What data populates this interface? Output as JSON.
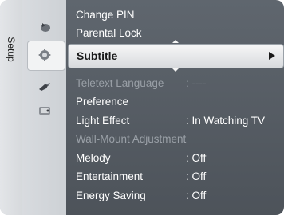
{
  "sidebar": {
    "label": "Setup"
  },
  "menu": {
    "items_top": [
      {
        "label": "Change PIN"
      },
      {
        "label": "Parental Lock"
      }
    ],
    "selected": {
      "label": "Subtitle",
      "arrow": "right-arrow-icon"
    },
    "items_bottom": [
      {
        "label": "Teletext Language",
        "value": ": ----",
        "enabled": false
      },
      {
        "label": "Preference",
        "value": "",
        "enabled": true
      },
      {
        "label": "Light Effect",
        "value": ": In Watching TV",
        "enabled": true
      },
      {
        "label": "Wall-Mount Adjustment",
        "value": "",
        "enabled": false
      },
      {
        "label": "Melody",
        "value": ": Off",
        "enabled": true
      },
      {
        "label": "Entertainment",
        "value": ": Off",
        "enabled": true
      },
      {
        "label": "Energy Saving",
        "value": ": Off",
        "enabled": true
      }
    ]
  },
  "colors": {
    "panel": "#5f666e",
    "selected_bg": "#f2f3f4",
    "dim_text": "#9aa0a7",
    "text": "#ffffff"
  },
  "icons": [
    "picture-icon",
    "setup-gear-icon",
    "input-icon",
    "application-icon"
  ]
}
